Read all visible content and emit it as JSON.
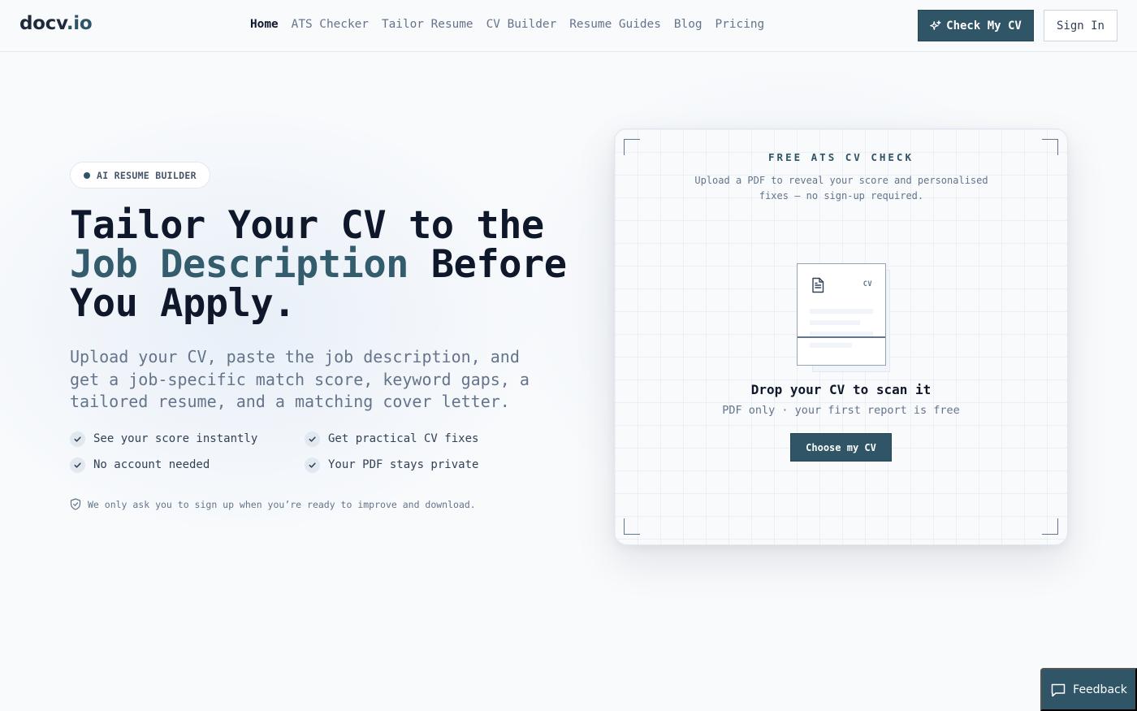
{
  "header": {
    "logo_main": "docv",
    "logo_suffix": ".io",
    "nav": [
      {
        "label": "Home",
        "active": true
      },
      {
        "label": "ATS Checker",
        "active": false
      },
      {
        "label": "Tailor Resume",
        "active": false
      },
      {
        "label": "CV Builder",
        "active": false
      },
      {
        "label": "Resume Guides",
        "active": false
      },
      {
        "label": "Blog",
        "active": false
      },
      {
        "label": "Pricing",
        "active": false
      }
    ],
    "cta_label": "Check My CV",
    "cta_icon": "sparkle-icon",
    "signin_label": "Sign In"
  },
  "hero": {
    "badge": "AI RESUME BUILDER",
    "title_line1": "Tailor Your CV to the",
    "title_accent": "Job Description",
    "title_after_accent": " Before",
    "title_line3": "You Apply.",
    "subtitle": "Upload your CV, paste the job description, and get a job-specific match score, keyword gaps, a tailored resume, and a matching cover letter.",
    "features": [
      "See your score instantly",
      "Get practical CV fixes",
      "No account needed",
      "Your PDF stays private"
    ],
    "note": "We only ask you to sign up when you’re ready to improve and download.",
    "note_icon": "shield-check-icon"
  },
  "card": {
    "title": "FREE ATS CV CHECK",
    "description": "Upload a PDF to reveal your score and personalised fixes — no sign-up required.",
    "doc_tag": "CV",
    "doc_icon": "document-icon",
    "drop_title": "Drop your CV to scan it",
    "drop_subtitle": "PDF only · your first report is free",
    "button_label": "Choose my CV"
  },
  "feedback": {
    "label": "Feedback",
    "icon": "chat-bubble-icon"
  },
  "colors": {
    "brand": "#2f5566",
    "accent_text": "#335c6d",
    "text_dark": "#0f172a",
    "text_muted": "#64748b",
    "background": "#f8fafc"
  }
}
